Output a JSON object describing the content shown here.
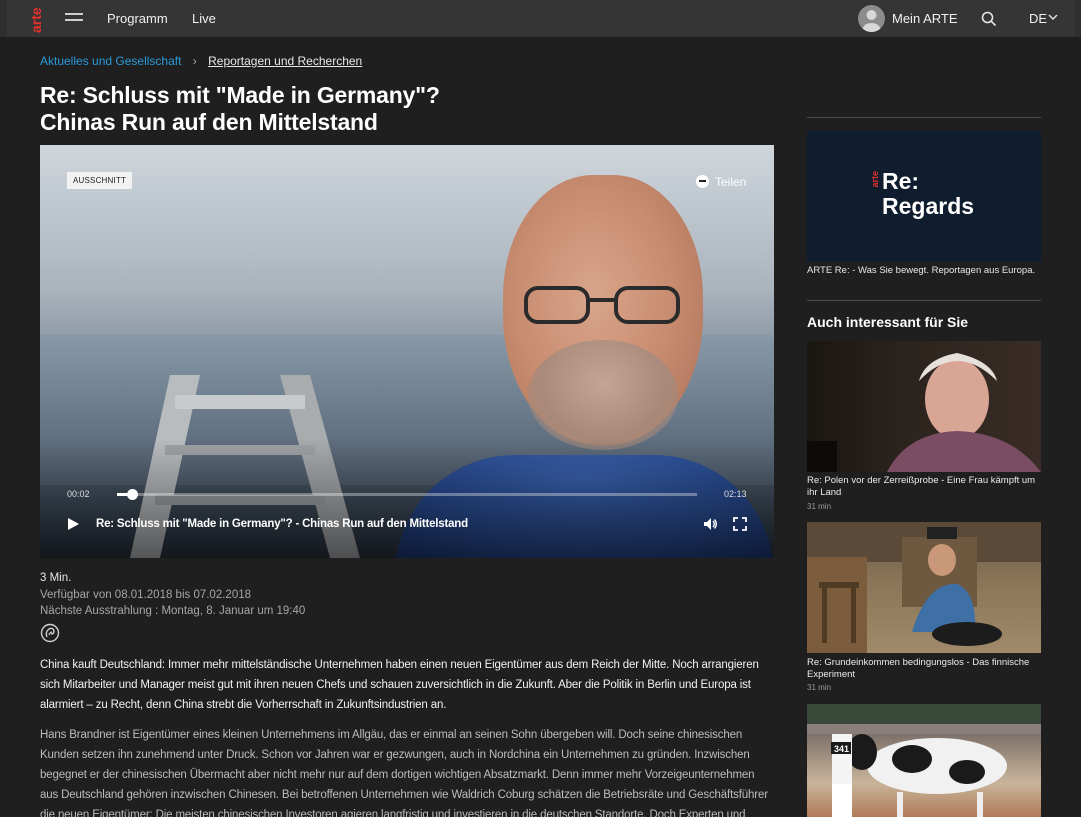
{
  "header": {
    "logo_text": "arte",
    "nav": {
      "programm": "Programm",
      "live": "Live"
    },
    "mein_arte": "Mein ARTE",
    "language": "DE",
    "colors": {
      "logo": "#e5322d",
      "bar": "#353535"
    }
  },
  "breadcrumb": {
    "parent": "Aktuelles und Gesellschaft",
    "current": "Reportagen und Recherchen"
  },
  "page": {
    "title_line1": "Re: Schluss mit \"Made in Germany\"?",
    "title_line2": "Chinas Run auf den Mittelstand"
  },
  "player": {
    "badge": "AUSSCHNITT",
    "share_label": "Teilen",
    "time_current": "00:02",
    "time_total": "02:13",
    "progress": 0.025,
    "title": "Re: Schluss mit \"Made in Germany\"? - Chinas Run auf den Mittelstand",
    "icons": [
      "play-icon",
      "volume-icon",
      "fullscreen-icon",
      "share-icon"
    ]
  },
  "meta": {
    "duration": "3 Min.",
    "availability": "Verfügbar von 08.01.2018 bis 07.02.2018",
    "next_broadcast": "Nächste Ausstrahlung : Montag, 8. Januar um 19:40"
  },
  "description": {
    "lead": "China kauft Deutschland: Immer mehr mittelständische Unternehmen haben einen neuen Eigentümer aus dem Reich der Mitte. Noch arrangieren sich Mitarbeiter und Manager meist gut mit ihren neuen Chefs und schauen zuversichtlich in die Zukunft. Aber die Politik in Berlin und Europa ist alarmiert –  zu Recht, denn China strebt die Vorherrschaft in Zukunftsindustrien an.",
    "body": "Hans Brandner ist Eigentümer eines kleinen Unternehmens im Allgäu, das er einmal an seinen Sohn übergeben will. Doch seine chinesischen Kunden setzen ihn zunehmend unter Druck. Schon vor Jahren war er gezwungen, auch in Nordchina ein Unternehmen zu gründen. Inzwischen begegnet er der chinesischen Übermacht aber nicht mehr nur auf dem dortigen wichtigen Absatzmarkt. Denn immer mehr Vorzeigeunternehmen aus Deutschland gehören inzwischen Chinesen. Bei betroffenen Unternehmen wie Waldrich Coburg schätzen die Betriebsräte und Geschäftsführer die neuen Eigentümer: Die meisten chinesischen Investoren agieren langfristig und investieren in die deutschen Standorte. Doch Experten und Politiker machen"
  },
  "sidebar": {
    "promo": {
      "logo_small": "arte",
      "logo_line1": "Re:",
      "logo_line2": "Regards",
      "caption": "ARTE Re: - Was Sie bewegt. Reportagen aus Europa."
    },
    "section_title": "Auch interessant für Sie",
    "teasers": [
      {
        "title": "Re: Polen vor der Zerreißprobe - Eine Frau kämpft um ihr Land",
        "duration": "31 min"
      },
      {
        "title": "Re: Grundeinkommen bedingungslos - Das finnische Experiment",
        "duration": "31 min"
      },
      {
        "title": "",
        "duration": "",
        "badge_number": "341"
      }
    ]
  }
}
